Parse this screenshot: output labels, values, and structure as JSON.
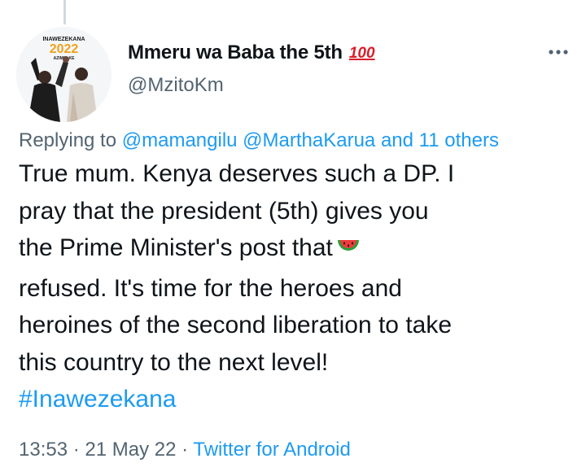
{
  "avatar": {
    "top_text": "INAWEZEKANA",
    "year": "2022",
    "sub_text": "AZIMIO.KE"
  },
  "author": {
    "display_name": "Mmeru wa Baba the 5th",
    "badge_emoji": "💯",
    "handle": "@MzitoKm"
  },
  "reply": {
    "prefix": "Replying to",
    "mention_1": "@mamangilu",
    "mention_2": "@MarthaKarua",
    "others": "and 11 others"
  },
  "tweet": {
    "line_1": "True mum.  Kenya deserves such a DP.  I",
    "line_2": "pray that the president (5th) gives you",
    "line_3": "the Prime Minister's post that",
    "line_4": "refused.  It's time for the heroes and",
    "line_5": "heroines of the second liberation to take",
    "line_6": "this country to the next level!",
    "hashtag": "#Inawezekana",
    "inline_emoji": "watermelon-icon"
  },
  "meta": {
    "time": "13:53",
    "separator": "·",
    "date": "21 May 22",
    "source": "Twitter for Android"
  },
  "colors": {
    "link": "#1d9bf0",
    "secondary_text": "#536471",
    "primary_text": "#0f1419",
    "badge_red": "#d81e2a"
  }
}
